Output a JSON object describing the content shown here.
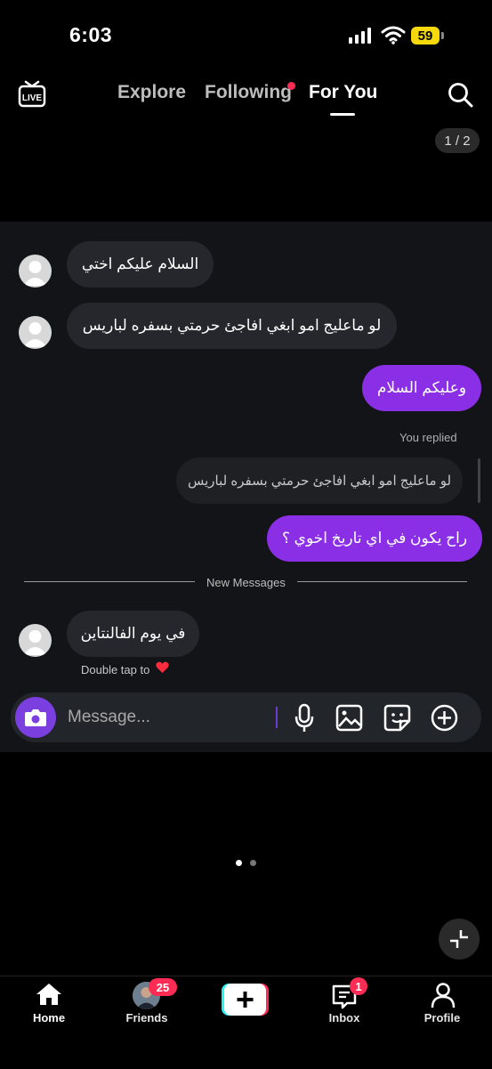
{
  "status": {
    "time": "6:03",
    "battery": "59"
  },
  "nav": {
    "explore": "Explore",
    "following": "Following",
    "for_you": "For You",
    "counter": "1 / 2"
  },
  "messages": {
    "m1": "السلام عليكم اختي",
    "m2": "لو ماعليج امو ابغي افاجئ حرمتي بسفره لباريس",
    "m3": "وعليكم السلام",
    "replied_label": "You replied",
    "quoted": "لو ماعليج امو ابغي افاجئ حرمتي بسفره لباريس",
    "m4": "راح يكون في اي تاريخ اخوي ؟",
    "divider": "New Messages",
    "m5": "في يوم الفالنتاين",
    "double_tap": "Double tap to"
  },
  "composer": {
    "placeholder": "Message..."
  },
  "bottom_nav": {
    "home": "Home",
    "friends": "Friends",
    "friends_badge": "25",
    "inbox": "Inbox",
    "inbox_badge": "1",
    "profile": "Profile"
  },
  "colors": {
    "accent": "#8b2fe6",
    "badge": "#fe2c55"
  }
}
